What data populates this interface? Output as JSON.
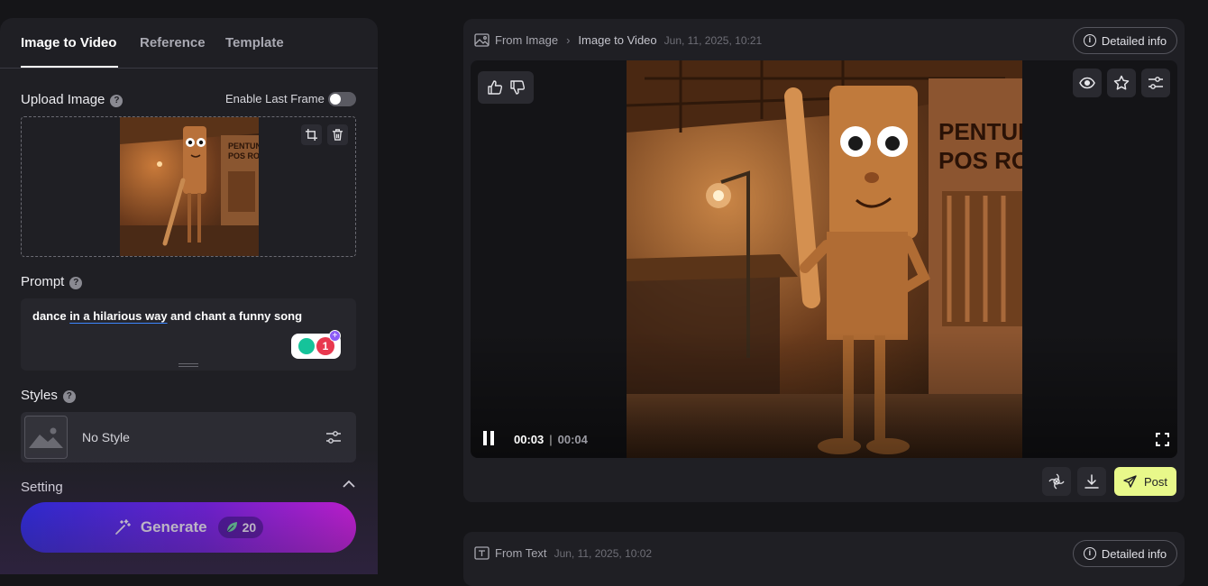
{
  "left_panel": {
    "tabs": [
      {
        "label": "Image to Video",
        "active": true
      },
      {
        "label": "Reference",
        "active": false
      },
      {
        "label": "Template",
        "active": false
      }
    ],
    "upload_label": "Upload Image",
    "enable_last_frame_label": "Enable Last Frame",
    "enable_last_frame_on": false,
    "thumb_sign": [
      "PENTUNG",
      "POS RONI"
    ],
    "prompt_label": "Prompt",
    "prompt": {
      "before": "dance ",
      "underlined": "in a hilarious way",
      "after": " and chant a funny song"
    },
    "grammarly_count": "1",
    "styles_label": "Styles",
    "style_value": "No Style",
    "setting_label": "Setting",
    "generate_label": "Generate",
    "credits": "20"
  },
  "result_card": {
    "breadcrumb": {
      "source": "From Image",
      "mode": "Image to Video",
      "date": "Jun, 11, 2025, 10:21"
    },
    "detail_label": "Detailed info",
    "video_sign": [
      "PENTUNG",
      "POS RONI"
    ],
    "current_time": "00:03",
    "duration": "00:04",
    "post_label": "Post"
  },
  "second_card": {
    "source": "From Text",
    "date": "Jun, 11, 2025, 10:02",
    "detail_label": "Detailed info"
  },
  "colors": {
    "accent_post": "#e8f88a",
    "generate_start": "#2a2bf5",
    "generate_end": "#e21cf0",
    "tab_underline": "#ffffff",
    "prompt_underline": "#3d86ff"
  },
  "icons": [
    "help-icon",
    "crop-icon",
    "trash-icon",
    "image-placeholder-icon",
    "sliders-icon",
    "chevron-up-icon",
    "magic-wand-icon",
    "leaf-icon",
    "image-icon",
    "chevron-right-icon",
    "info-icon",
    "thumbs-up-icon",
    "thumbs-down-icon",
    "eye-icon",
    "star-icon",
    "pause-icon",
    "fullscreen-icon",
    "ai-icon",
    "download-icon",
    "send-icon",
    "text-icon"
  ]
}
